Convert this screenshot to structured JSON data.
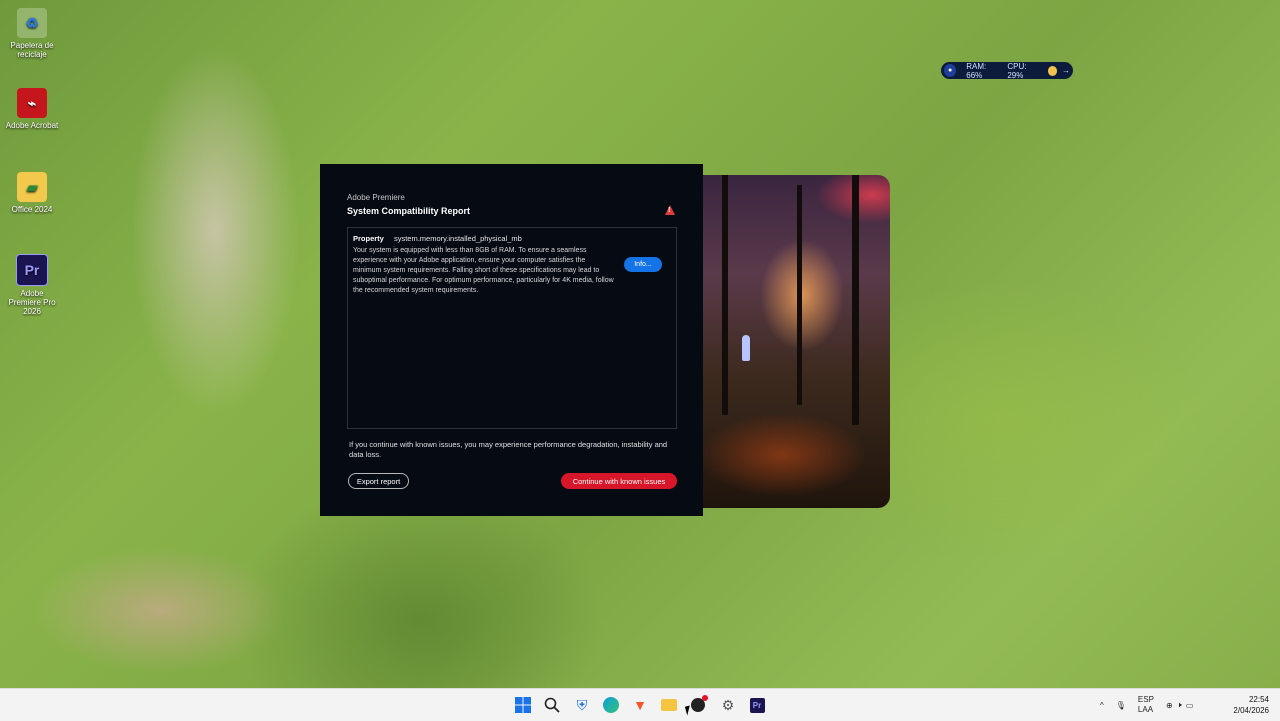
{
  "desktop": {
    "icons": [
      {
        "label": "Papelera de reciclaje",
        "icon": "recycle-bin-icon"
      },
      {
        "label": "Adobe Acrobat",
        "icon": "acrobat-icon"
      },
      {
        "label": "Office 2024",
        "icon": "office-folder-icon"
      },
      {
        "label": "Adobe Premiere Pro 2026",
        "icon": "premiere-icon",
        "badge": "Pr"
      }
    ]
  },
  "monitor_widget": {
    "ram": "RAM: 66%",
    "cpu": "CPU: 29%"
  },
  "dialog": {
    "app_name": "Adobe Premiere",
    "title": "System Compatibility Report",
    "property_label": "Property",
    "property_value": "system.memory.installed_physical_mb",
    "description": "Your system is equipped with less than 8GB of RAM.  To ensure a seamless experience with your Adobe application, ensure your computer satisfies the minimum system requirements. Falling short of these specifications may lead to suboptimal performance. For optimum performance, particularly for 4K media, follow the recommended system requirements.",
    "info_button": "Info...",
    "footnote": "If you continue with known issues, you may experience performance degradation, instability and data loss.",
    "export_button": "Export report",
    "continue_button": "Continue with known issues"
  },
  "taskbar": {
    "apps": [
      {
        "name": "start-icon"
      },
      {
        "name": "search-icon"
      },
      {
        "name": "defender-icon"
      },
      {
        "name": "edge-icon"
      },
      {
        "name": "brave-icon"
      },
      {
        "name": "file-explorer-icon"
      },
      {
        "name": "github-icon"
      },
      {
        "name": "settings-icon"
      },
      {
        "name": "premiere-icon"
      }
    ],
    "tray": {
      "language_top": "ESP",
      "language_bottom": "LAA",
      "time": "22:54",
      "date": "2/04/2026"
    }
  },
  "colors": {
    "accent_blue": "#1473e6",
    "continue_red": "#d7162a",
    "dialog_bg": "#050a13"
  }
}
